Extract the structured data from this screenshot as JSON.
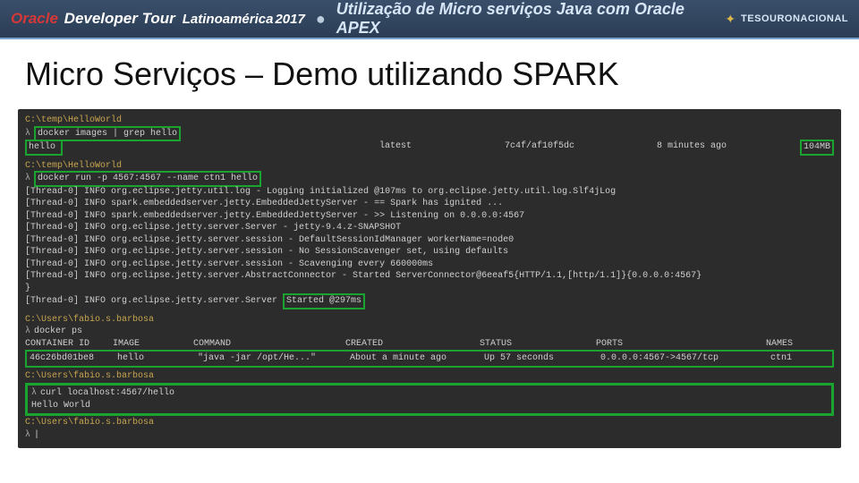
{
  "header": {
    "brand1": "Oracle",
    "brand2": " Developer Tour",
    "subbrand": "Latinoamérica",
    "year": " 2017",
    "sep": "●",
    "title": "Utilização de Micro serviços Java com Oracle APEX",
    "logo_text": "TESOURONACIONAL"
  },
  "slide_title": "Micro Serviços – Demo utilizando SPARK",
  "term": {
    "path1": "C:\\temp\\HelloWorld",
    "sym": "λ",
    "cmd_images": "docker images | grep hello",
    "img_row": {
      "name": "hello",
      "tag": "latest",
      "id": "7c4f/af10f5dc",
      "created": "8 minutes ago",
      "size": "104MB"
    },
    "cmd_run": "docker run -p 4567:4567 --name ctn1 hello",
    "log1": "[Thread-0] INFO org.eclipse.jetty.util.log - Logging initialized @107ms to org.eclipse.jetty.util.log.Slf4jLog",
    "log2": "[Thread-0] INFO spark.embeddedserver.jetty.EmbeddedJettyServer - == Spark has ignited ...",
    "log3": "[Thread-0] INFO spark.embeddedserver.jetty.EmbeddedJettyServer - >> Listening on 0.0.0.0:4567",
    "log4": "[Thread-0] INFO org.eclipse.jetty.server.Server - jetty-9.4.z-SNAPSHOT",
    "log5": "[Thread-0] INFO org.eclipse.jetty.server.session - DefaultSessionIdManager workerName=node0",
    "log6": "[Thread-0] INFO org.eclipse.jetty.server.session - No SessionScavenger set, using defaults",
    "log7": "[Thread-0] INFO org.eclipse.jetty.server.session - Scavenging every 660000ms",
    "log8": "[Thread-0] INFO org.eclipse.jetty.server.AbstractConnector - Started ServerConnector@6eeaf5{HTTP/1.1,[http/1.1]}{0.0.0.0:4567}",
    "log9a": "[Thread-0] INFO org.eclipse.jetty.server.Server ",
    "log9b": "Started @297ms",
    "path2": "C:\\Users\\fabio.s.barbosa",
    "cmd_ps": "docker ps",
    "ps_head": {
      "id": "CONTAINER ID",
      "img": "IMAGE",
      "cmd": "COMMAND",
      "crt": "CREATED",
      "sts": "STATUS",
      "prt": "PORTS",
      "nm": "NAMES"
    },
    "ps_row": {
      "id": "46c26bd01be8",
      "img": "hello",
      "cmd": "\"java -jar /opt/He...\"",
      "crt": "About a minute ago",
      "sts": "Up 57 seconds",
      "prt": "0.0.0.0:4567->4567/tcp",
      "nm": "ctn1"
    },
    "cmd_curl": "curl localhost:4567/hello",
    "curl_out": "Hello World"
  }
}
